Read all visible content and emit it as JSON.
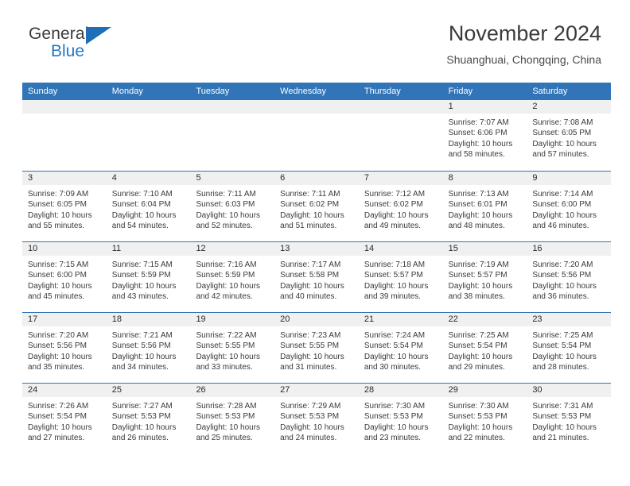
{
  "brand": {
    "name_top": "General",
    "name_bottom": "Blue",
    "accent_color": "#1f6fb8"
  },
  "header": {
    "title": "November 2024",
    "subtitle": "Shuanghuai, Chongqing, China"
  },
  "theme": {
    "header_blue": "#3175b8",
    "day_band_gray": "#f0f0f0",
    "text": "#2a2a2a"
  },
  "weekdays": [
    "Sunday",
    "Monday",
    "Tuesday",
    "Wednesday",
    "Thursday",
    "Friday",
    "Saturday"
  ],
  "weeks": [
    [
      {
        "day": "",
        "lines": []
      },
      {
        "day": "",
        "lines": []
      },
      {
        "day": "",
        "lines": []
      },
      {
        "day": "",
        "lines": []
      },
      {
        "day": "",
        "lines": []
      },
      {
        "day": "1",
        "lines": [
          "Sunrise: 7:07 AM",
          "Sunset: 6:06 PM",
          "Daylight: 10 hours",
          "and 58 minutes."
        ]
      },
      {
        "day": "2",
        "lines": [
          "Sunrise: 7:08 AM",
          "Sunset: 6:05 PM",
          "Daylight: 10 hours",
          "and 57 minutes."
        ]
      }
    ],
    [
      {
        "day": "3",
        "lines": [
          "Sunrise: 7:09 AM",
          "Sunset: 6:05 PM",
          "Daylight: 10 hours",
          "and 55 minutes."
        ]
      },
      {
        "day": "4",
        "lines": [
          "Sunrise: 7:10 AM",
          "Sunset: 6:04 PM",
          "Daylight: 10 hours",
          "and 54 minutes."
        ]
      },
      {
        "day": "5",
        "lines": [
          "Sunrise: 7:11 AM",
          "Sunset: 6:03 PM",
          "Daylight: 10 hours",
          "and 52 minutes."
        ]
      },
      {
        "day": "6",
        "lines": [
          "Sunrise: 7:11 AM",
          "Sunset: 6:02 PM",
          "Daylight: 10 hours",
          "and 51 minutes."
        ]
      },
      {
        "day": "7",
        "lines": [
          "Sunrise: 7:12 AM",
          "Sunset: 6:02 PM",
          "Daylight: 10 hours",
          "and 49 minutes."
        ]
      },
      {
        "day": "8",
        "lines": [
          "Sunrise: 7:13 AM",
          "Sunset: 6:01 PM",
          "Daylight: 10 hours",
          "and 48 minutes."
        ]
      },
      {
        "day": "9",
        "lines": [
          "Sunrise: 7:14 AM",
          "Sunset: 6:00 PM",
          "Daylight: 10 hours",
          "and 46 minutes."
        ]
      }
    ],
    [
      {
        "day": "10",
        "lines": [
          "Sunrise: 7:15 AM",
          "Sunset: 6:00 PM",
          "Daylight: 10 hours",
          "and 45 minutes."
        ]
      },
      {
        "day": "11",
        "lines": [
          "Sunrise: 7:15 AM",
          "Sunset: 5:59 PM",
          "Daylight: 10 hours",
          "and 43 minutes."
        ]
      },
      {
        "day": "12",
        "lines": [
          "Sunrise: 7:16 AM",
          "Sunset: 5:59 PM",
          "Daylight: 10 hours",
          "and 42 minutes."
        ]
      },
      {
        "day": "13",
        "lines": [
          "Sunrise: 7:17 AM",
          "Sunset: 5:58 PM",
          "Daylight: 10 hours",
          "and 40 minutes."
        ]
      },
      {
        "day": "14",
        "lines": [
          "Sunrise: 7:18 AM",
          "Sunset: 5:57 PM",
          "Daylight: 10 hours",
          "and 39 minutes."
        ]
      },
      {
        "day": "15",
        "lines": [
          "Sunrise: 7:19 AM",
          "Sunset: 5:57 PM",
          "Daylight: 10 hours",
          "and 38 minutes."
        ]
      },
      {
        "day": "16",
        "lines": [
          "Sunrise: 7:20 AM",
          "Sunset: 5:56 PM",
          "Daylight: 10 hours",
          "and 36 minutes."
        ]
      }
    ],
    [
      {
        "day": "17",
        "lines": [
          "Sunrise: 7:20 AM",
          "Sunset: 5:56 PM",
          "Daylight: 10 hours",
          "and 35 minutes."
        ]
      },
      {
        "day": "18",
        "lines": [
          "Sunrise: 7:21 AM",
          "Sunset: 5:56 PM",
          "Daylight: 10 hours",
          "and 34 minutes."
        ]
      },
      {
        "day": "19",
        "lines": [
          "Sunrise: 7:22 AM",
          "Sunset: 5:55 PM",
          "Daylight: 10 hours",
          "and 33 minutes."
        ]
      },
      {
        "day": "20",
        "lines": [
          "Sunrise: 7:23 AM",
          "Sunset: 5:55 PM",
          "Daylight: 10 hours",
          "and 31 minutes."
        ]
      },
      {
        "day": "21",
        "lines": [
          "Sunrise: 7:24 AM",
          "Sunset: 5:54 PM",
          "Daylight: 10 hours",
          "and 30 minutes."
        ]
      },
      {
        "day": "22",
        "lines": [
          "Sunrise: 7:25 AM",
          "Sunset: 5:54 PM",
          "Daylight: 10 hours",
          "and 29 minutes."
        ]
      },
      {
        "day": "23",
        "lines": [
          "Sunrise: 7:25 AM",
          "Sunset: 5:54 PM",
          "Daylight: 10 hours",
          "and 28 minutes."
        ]
      }
    ],
    [
      {
        "day": "24",
        "lines": [
          "Sunrise: 7:26 AM",
          "Sunset: 5:54 PM",
          "Daylight: 10 hours",
          "and 27 minutes."
        ]
      },
      {
        "day": "25",
        "lines": [
          "Sunrise: 7:27 AM",
          "Sunset: 5:53 PM",
          "Daylight: 10 hours",
          "and 26 minutes."
        ]
      },
      {
        "day": "26",
        "lines": [
          "Sunrise: 7:28 AM",
          "Sunset: 5:53 PM",
          "Daylight: 10 hours",
          "and 25 minutes."
        ]
      },
      {
        "day": "27",
        "lines": [
          "Sunrise: 7:29 AM",
          "Sunset: 5:53 PM",
          "Daylight: 10 hours",
          "and 24 minutes."
        ]
      },
      {
        "day": "28",
        "lines": [
          "Sunrise: 7:30 AM",
          "Sunset: 5:53 PM",
          "Daylight: 10 hours",
          "and 23 minutes."
        ]
      },
      {
        "day": "29",
        "lines": [
          "Sunrise: 7:30 AM",
          "Sunset: 5:53 PM",
          "Daylight: 10 hours",
          "and 22 minutes."
        ]
      },
      {
        "day": "30",
        "lines": [
          "Sunrise: 7:31 AM",
          "Sunset: 5:53 PM",
          "Daylight: 10 hours",
          "and 21 minutes."
        ]
      }
    ]
  ]
}
